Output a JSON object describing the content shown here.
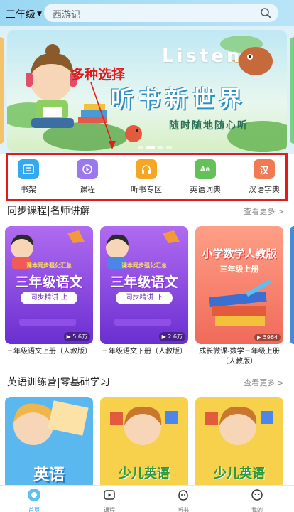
{
  "header": {
    "grade": "三年级",
    "search_placeholder": "西游记"
  },
  "banner": {
    "listen": "Listen",
    "title": "听书新世界",
    "subtitle": "随时随地随心听",
    "annotation": "多种选择"
  },
  "categories": [
    {
      "label": "书架",
      "icon": "bookshelf-icon",
      "color": "#35a9f0"
    },
    {
      "label": "课程",
      "icon": "course-play-icon",
      "color": "#9b78f0"
    },
    {
      "label": "听书专区",
      "icon": "headphones-icon",
      "color": "#f5a623"
    },
    {
      "label": "英语词典",
      "icon": "dictionary-icon",
      "color": "#62c257"
    },
    {
      "label": "汉语字典",
      "icon": "chinese-dict-icon",
      "color": "#f27a52",
      "glyph": "汉"
    }
  ],
  "sync_section": {
    "title": "同步课程|名师讲解",
    "more": "查看更多 >",
    "cards": [
      {
        "heading": "三年级语文",
        "small": "课本同步强化汇总",
        "pill": "同步精讲 上",
        "plays": "5.6万",
        "caption": "三年级语文上册（人教版）"
      },
      {
        "heading": "三年级语文",
        "small": "课本同步强化汇总",
        "pill": "同步精讲 下",
        "plays": "2.6万",
        "caption": "三年级语文下册（人教版）"
      },
      {
        "heading": "小学数学人教版",
        "small": "三年级上册",
        "plays": "5964",
        "caption": "成长微课-数学三年级上册（人教版）"
      }
    ]
  },
  "english_section": {
    "title": "英语训练营|零基础学习",
    "more": "查看更多 >",
    "cards": [
      {
        "text": "英语"
      },
      {
        "text": "少儿英语"
      },
      {
        "text": "少儿英语"
      }
    ]
  },
  "bottom_nav": [
    {
      "label": "首页",
      "icon": "home-icon",
      "active": true
    },
    {
      "label": "课程",
      "icon": "course-icon",
      "active": false
    },
    {
      "label": "听书",
      "icon": "listen-icon",
      "active": false
    },
    {
      "label": "我的",
      "icon": "profile-icon",
      "active": false
    }
  ],
  "colors": {
    "accent": "#2aa7e6",
    "annotation_red": "#e31b1b"
  }
}
